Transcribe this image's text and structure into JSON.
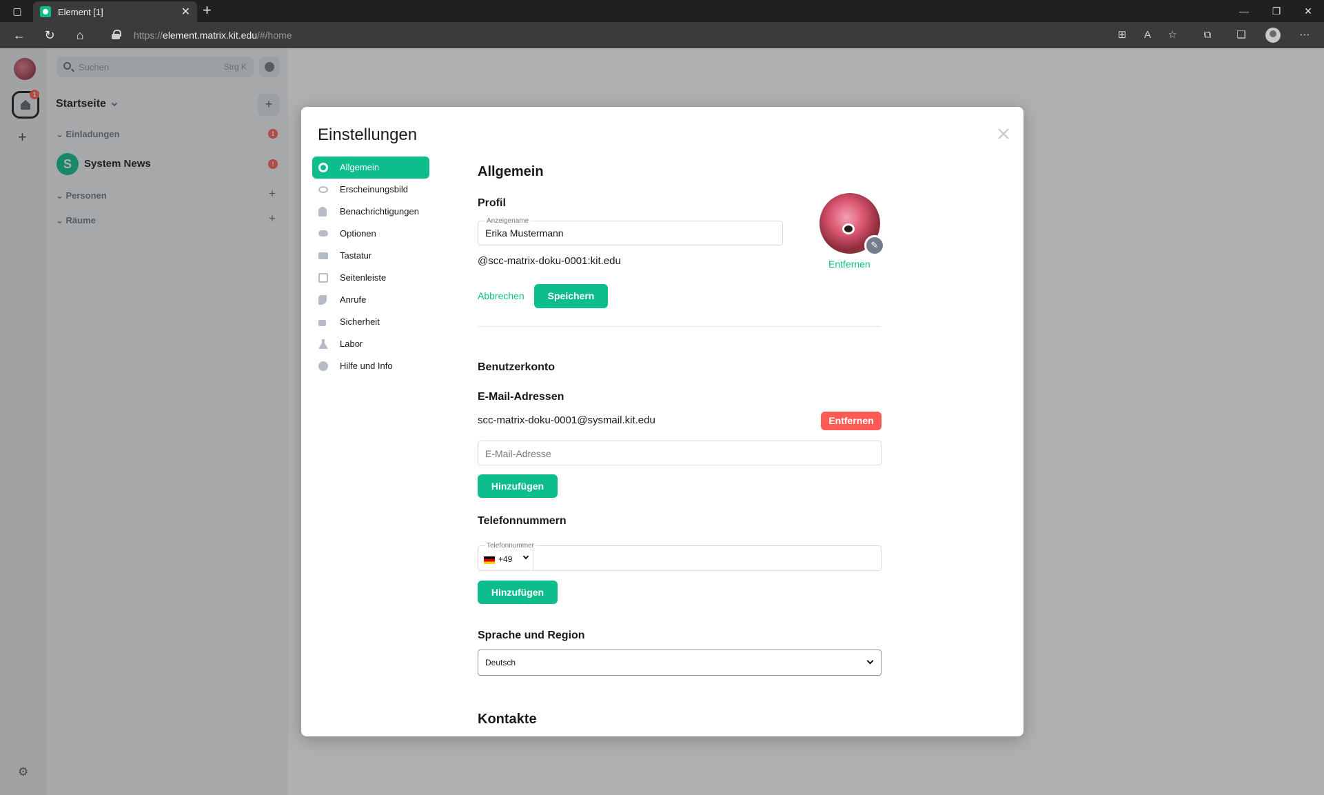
{
  "browser": {
    "tab_title": "Element [1]",
    "url_scheme": "https://",
    "url_host": "element.matrix.kit.edu",
    "url_path": "/#/home"
  },
  "sidebar": {
    "search_placeholder": "Suchen",
    "search_shortcut": "Strg K",
    "home_title": "Startseite",
    "home_badge": "1",
    "sections": {
      "invites": "Einladungen",
      "invites_badge": "1",
      "people": "Personen",
      "rooms": "Räume"
    },
    "room": {
      "initial": "S",
      "name": "System News",
      "badge": "!"
    }
  },
  "settings": {
    "title": "Einstellungen",
    "nav": [
      {
        "label": "Allgemein",
        "icon": "gear-icon"
      },
      {
        "label": "Erscheinungsbild",
        "icon": "eye-icon"
      },
      {
        "label": "Benachrichtigungen",
        "icon": "bell-icon"
      },
      {
        "label": "Optionen",
        "icon": "toggle-icon"
      },
      {
        "label": "Tastatur",
        "icon": "keyboard-icon"
      },
      {
        "label": "Seitenleiste",
        "icon": "sidebar-icon"
      },
      {
        "label": "Anrufe",
        "icon": "phone-icon"
      },
      {
        "label": "Sicherheit",
        "icon": "lock-icon"
      },
      {
        "label": "Labor",
        "icon": "flask-icon"
      },
      {
        "label": "Hilfe und Info",
        "icon": "help-icon"
      }
    ],
    "general": {
      "heading": "Allgemein",
      "profile": {
        "heading": "Profil",
        "display_name_label": "Anzeigename",
        "display_name_value": "Erika Mustermann",
        "matrix_id": "@scc-matrix-doku-0001:kit.edu",
        "cancel": "Abbrechen",
        "save": "Speichern",
        "avatar_remove": "Entfernen"
      },
      "account": {
        "heading": "Benutzerkonto",
        "email_heading": "E-Mail-Adressen",
        "email_address": "scc-matrix-doku-0001@sysmail.kit.edu",
        "email_remove": "Entfernen",
        "email_placeholder": "E-Mail-Adresse",
        "email_add": "Hinzufügen",
        "phone_heading": "Telefonnummern",
        "phone_label": "Telefonnummer",
        "phone_prefix": "+49",
        "phone_add": "Hinzufügen"
      },
      "language": {
        "heading": "Sprache und Region",
        "selected": "Deutsch"
      },
      "contacts_heading": "Kontakte"
    }
  },
  "colors": {
    "accent": "#0dbd8b",
    "danger": "#ff5b55"
  }
}
